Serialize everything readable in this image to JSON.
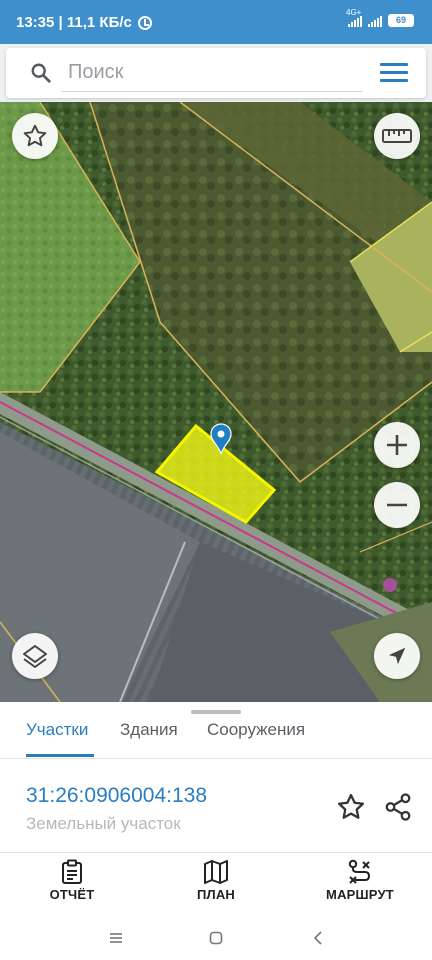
{
  "status_bar": {
    "time_speed": "13:35 | 11,1 КБ/с",
    "network": "4G+",
    "battery": "69"
  },
  "search": {
    "placeholder": "Поиск"
  },
  "map": {
    "icons": [
      "star-icon",
      "ruler-icon",
      "zoom-in-icon",
      "zoom-out-icon",
      "layers-icon",
      "location-arrow-icon",
      "location-pin-icon"
    ],
    "colors": {
      "selected_parcel_fill": "#e6ee18",
      "selected_parcel_border": "#f5f500",
      "parcel_border": "#d9b35a",
      "road_line": "#c8388c",
      "pin": "#1e7fc4"
    }
  },
  "tabs": [
    {
      "label": "Участки",
      "active": true
    },
    {
      "label": "Здания",
      "active": false
    },
    {
      "label": "Сооружения",
      "active": false
    }
  ],
  "parcel": {
    "number": "31:26:0906004:138",
    "type": "Земельный участок"
  },
  "bottom_nav": [
    {
      "label": "ОТЧЁТ",
      "icon": "report-icon"
    },
    {
      "label": "ПЛАН",
      "icon": "map-plan-icon"
    },
    {
      "label": "МАРШРУТ",
      "icon": "route-icon"
    }
  ],
  "accent_color": "#2a7dc0"
}
